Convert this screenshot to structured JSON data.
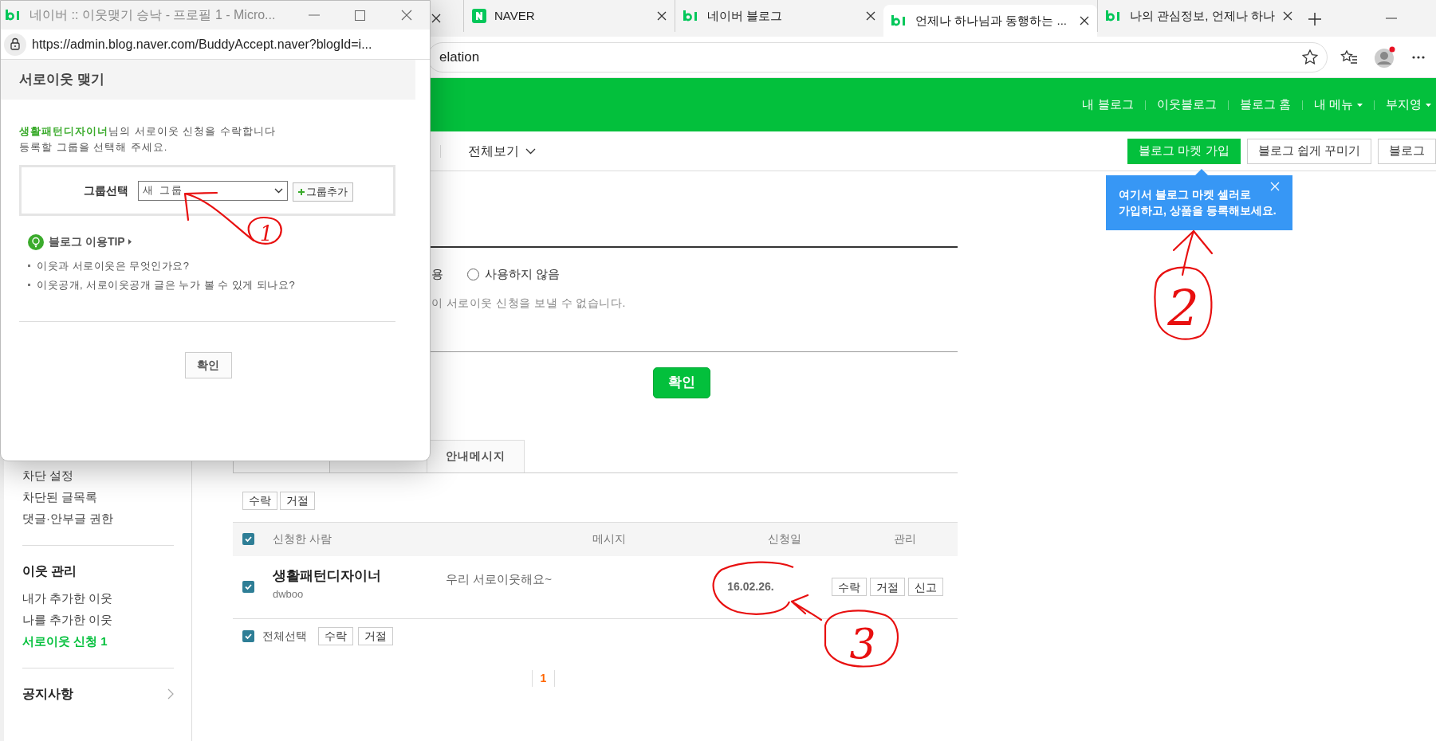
{
  "browser": {
    "tabs": [
      {
        "label": "NAVER",
        "selected": false
      },
      {
        "label": "네이버 블로그",
        "selected": false
      },
      {
        "label": "언제나 하나님과 동행하는 ...",
        "selected": true
      },
      {
        "label": "나의 관심정보, 언제나 하나",
        "selected": false
      }
    ],
    "address_tail": "elation"
  },
  "header": {
    "menu": [
      {
        "label": "내 블로그",
        "dropdown": false
      },
      {
        "label": "이웃블로그",
        "dropdown": false
      },
      {
        "label": "블로그 홈",
        "dropdown": false
      },
      {
        "label": "내 메뉴",
        "dropdown": true
      },
      {
        "label": "부지영",
        "dropdown": true
      }
    ]
  },
  "subnav": {
    "view_all": "전체보기",
    "buttons": [
      {
        "label": "블로그 마켓 가입",
        "kind": "primary"
      },
      {
        "label": "블로그 쉽게 꾸미기",
        "kind": "outline"
      },
      {
        "label": "블로그",
        "kind": "outline"
      }
    ]
  },
  "tooltip": {
    "lines": [
      "여기서 블로그 마켓 셀러로",
      "가입하고, 상품을 등록해보세요."
    ]
  },
  "sidebar": {
    "groups": [
      {
        "items": [
          {
            "label": "차단 설정",
            "selected": false
          },
          {
            "label": "차단된 글목록",
            "selected": false
          },
          {
            "label": "댓글·안부글 권한",
            "selected": false
          }
        ]
      },
      {
        "title": "이웃 관리",
        "items": [
          {
            "label": "내가 추가한 이웃",
            "selected": false
          },
          {
            "label": "나를 추가한 이웃",
            "selected": false
          },
          {
            "label": "서로이웃 신청 1",
            "selected": true
          }
        ]
      },
      {
        "title": "공지사항",
        "expandable": true
      }
    ]
  },
  "settings": {
    "option_tail": "용",
    "radio": {
      "label": "사용하지 않음",
      "selected": false
    },
    "note": "이 서로이웃 신청을 보낼 수 없습니다.",
    "confirm": "확인"
  },
  "requests": {
    "tabs": [
      {
        "label": "안내메시지",
        "selected": false
      }
    ],
    "top_actions": [
      "수락",
      "거절"
    ],
    "header_checked": true,
    "columns": [
      "신청한 사람",
      "메시지",
      "신청일",
      "관리"
    ],
    "rows": [
      {
        "checked": true,
        "name": "생활패턴디자이너",
        "id": "dwboo",
        "message": "우리 서로이웃해요~",
        "date": "16.02.26.",
        "actions": [
          "수락",
          "거절",
          "신고"
        ]
      }
    ],
    "select_all": {
      "label": "전체선택",
      "checked": true
    },
    "bottom_actions": [
      "수락",
      "거절"
    ],
    "pages": [
      {
        "label": "1",
        "selected": true
      }
    ]
  },
  "popup": {
    "window_title": "네이버 :: 이웃맺기 승낙 - 프로필 1 - Micro...",
    "url": "https://admin.blog.naver.com/BuddyAccept.naver?blogId=i...",
    "heading": "서로이웃 맺기",
    "message": "**생활패턴디자이너**님의 서로이웃 신청을 수락합니다",
    "message_line2": "등록할 그룹을 선택해 주세요.",
    "group_label": "그룹선택",
    "group_select": "새 그룹",
    "add_group_button": "그룹추가",
    "tip_title": "블로그 이용TIP",
    "tips": [
      "이웃과 서로이웃은 무엇인가요?",
      "이웃공개, 서로이웃공개 글은 누가 볼 수 있게 되나요?"
    ],
    "confirm": "확인"
  },
  "annotations": [
    {
      "label": "1"
    },
    {
      "label": "2"
    },
    {
      "label": "3"
    }
  ]
}
